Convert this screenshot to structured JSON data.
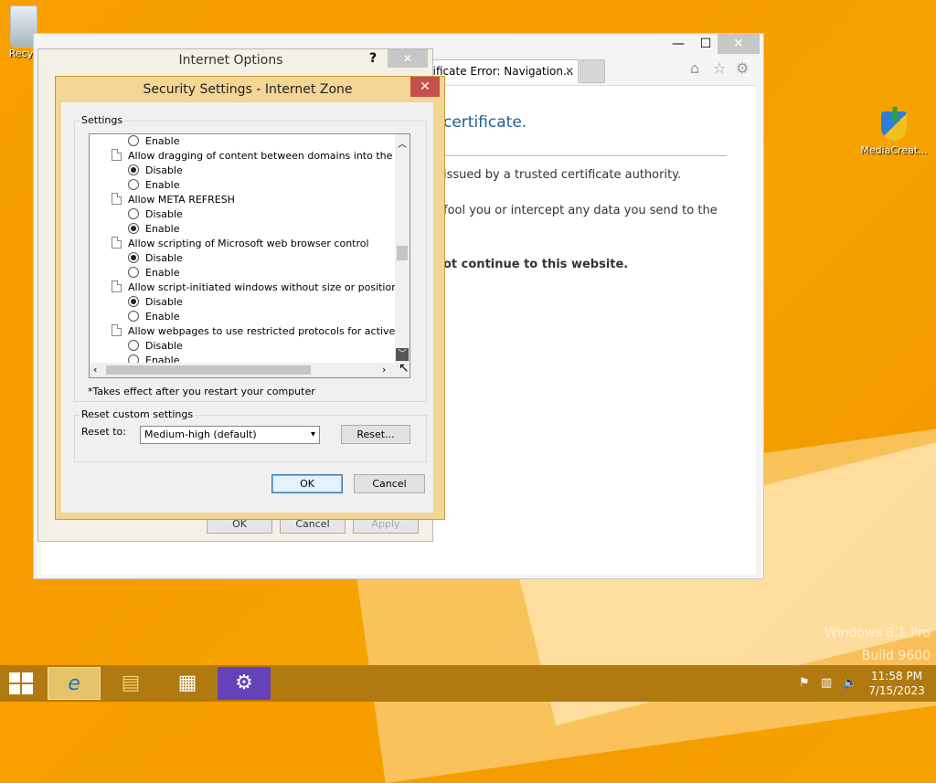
{
  "desktop": {
    "recycle_label": "Recyc",
    "media_label": "MediaCreat...",
    "watermark_line1": "Windows 8.1 Pro",
    "watermark_line2": "Build 9600"
  },
  "ie": {
    "tab_title": "rtificate Error: Navigation...",
    "tab_close": "✕",
    "heading": "certificate.",
    "line1": "issued by a trusted certificate authority.",
    "line2": "fool you or intercept any data you send to the",
    "line3": "ot continue to this website.",
    "min": "—",
    "max": "☐",
    "close": "✕",
    "home_icon": "⌂",
    "star_icon": "☆",
    "gear_icon": "⚙"
  },
  "internet_options": {
    "title": "Internet Options",
    "help": "?",
    "close": "✕",
    "ok": "OK",
    "cancel": "Cancel",
    "apply": "Apply"
  },
  "security": {
    "title": "Security Settings - Internet Zone",
    "close": "✕",
    "settings_label": "Settings",
    "rows": [
      {
        "type": "opt",
        "label": "Enable",
        "checked": false
      },
      {
        "type": "hdr",
        "label": "Allow dragging of content between domains into the same wi"
      },
      {
        "type": "opt",
        "label": "Disable",
        "checked": true
      },
      {
        "type": "opt",
        "label": "Enable",
        "checked": false
      },
      {
        "type": "hdr",
        "label": "Allow META REFRESH"
      },
      {
        "type": "opt",
        "label": "Disable",
        "checked": false
      },
      {
        "type": "opt",
        "label": "Enable",
        "checked": true
      },
      {
        "type": "hdr",
        "label": "Allow scripting of Microsoft web browser control"
      },
      {
        "type": "opt",
        "label": "Disable",
        "checked": true
      },
      {
        "type": "opt",
        "label": "Enable",
        "checked": false
      },
      {
        "type": "hdr",
        "label": "Allow script-initiated windows without size or position constra"
      },
      {
        "type": "opt",
        "label": "Disable",
        "checked": true
      },
      {
        "type": "opt",
        "label": "Enable",
        "checked": false
      },
      {
        "type": "hdr",
        "label": "Allow webpages to use restricted protocols for active conten"
      },
      {
        "type": "opt",
        "label": "Disable",
        "checked": false
      },
      {
        "type": "opt",
        "label": "Enable",
        "checked": false
      }
    ],
    "restart_note": "*Takes effect after you restart your computer",
    "reset_group_label": "Reset custom settings",
    "reset_to_label": "Reset to:",
    "reset_to_value": "Medium-high (default)",
    "reset_button": "Reset...",
    "ok": "OK",
    "cancel": "Cancel"
  },
  "taskbar": {
    "time": "11:58 PM",
    "date": "7/15/2023"
  }
}
